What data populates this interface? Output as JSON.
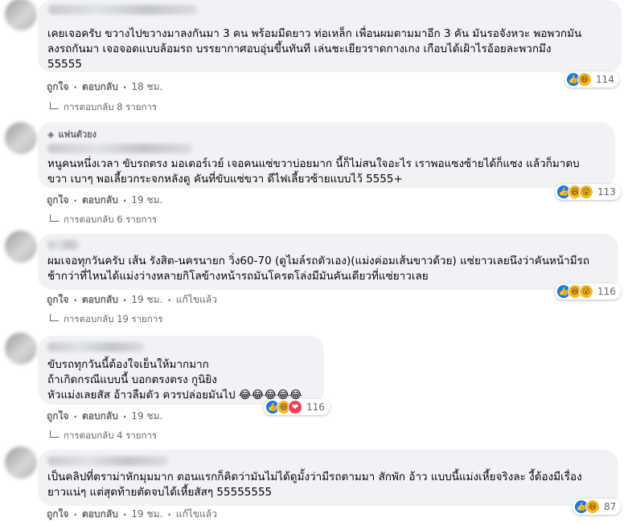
{
  "comments": [
    {
      "text": "เคยเจอครับ ขวางไปขวางมาลงกันมา 3 คน พร้อมมีดยาว ท่อเหล็ก เพื่อนผมตามมาอีก 3 คัน มันรอจังหวะ พอพวกมัน\nลงรถกันมา เจอจอดแบบล้อมรถ บรรยากาศอบอุ่นขึ้นทันที เล่นชะเยียวราดกางเกง เกือบได้เฝ้าไรอ้อยละพวกมึง\n55555",
      "like": "ถูกใจ",
      "reply": "ตอบกลับ",
      "time": "18 ชม.",
      "edited": "",
      "replies": "การตอบกลับ 8 รายการ",
      "reaction_count": "114",
      "reactions": [
        "like-icon",
        "haha-icon"
      ],
      "badge": ""
    },
    {
      "badge": "แฟนตัวยง",
      "text": "หนูคนหนึ่งเวลา ขับรถตรง มอเตอร์เวย์ เจอคนแซ่ขวาบ่อยมาก นี้ก็ไม่สนใจอะไร เราพอแซงซ้ายได้ก็แซง แล้วก็มาตบ\nขวา เบาๆ พอเลี้ยวกระจกหลังดู คันที่ขับแซ่ขวา ดีไฟเลี้ยวซ้ายแบบไว้ 5555+",
      "like": "ถูกใจ",
      "reply": "ตอบกลับ",
      "time": "19 ชม.",
      "edited": "",
      "replies": "การตอบกลับ 6 รายการ",
      "reaction_count": "113",
      "reactions": [
        "like-icon",
        "haha-icon",
        "wow-icon"
      ]
    },
    {
      "text": "ผมเจอทุกวันครับ เส้น รังสิต-นครนายก วิ่ง60-70 (ดูไมล์รถตัวเอง)(แม่งค่อมเส้นขาวด้วย) แซ่ยาวเลยนึงว่าคันหน้ามีรถ\nช้ากว่าที่ไหนได้แม่งว่างหลายกิโลข้างหน้ารถมันโครตโล่งมีมันคันเดียวที่แซ่ยาวเลย",
      "like": "ถูกใจ",
      "reply": "ตอบกลับ",
      "time": "19 ชม.",
      "edited": "แก้ไขแล้ว",
      "replies": "การตอบกลับ 19 รายการ",
      "reaction_count": "116",
      "reactions": [
        "like-icon",
        "haha-icon",
        "wow-icon"
      ],
      "badge": ""
    },
    {
      "text": "ขับรถทุกวันนี้ต้องใจเย็นให้มากมาก\nถ้าเกิดกรณีแบบนี้ บอกตรงตรง กูนิยิง\nหัวแม่งเลยสัส อ้าวลืมตัว ควรปล่อยมันไป 😂😂😂😂😂",
      "like": "ถูกใจ",
      "reply": "ตอบกลับ",
      "time": "19 ชม.",
      "edited": "",
      "replies": "การตอบกลับ 4 รายการ",
      "reaction_count": "116",
      "reactions": [
        "like-icon",
        "haha-icon",
        "love-icon"
      ],
      "badge": ""
    },
    {
      "text": "เป็นคลิปที่ตราม่าหักมุมมาก ตอนแรกก็คิดว่ามันไม่ได้ดูมั้งว่ามีรถตามมา สักพัก อ้าว แบบนี้แม่งเหี้ยจริงละ งี้ต้องมีเรื่อง\nยาวแน่ๆ แต่สุดท้ายตัดจบได้เหี้ยสัสๆ 55555555",
      "like": "ถูกใจ",
      "reply": "ตอบกลับ",
      "time": "19 ชม.",
      "edited": "แก้ไขแล้ว",
      "replies": "",
      "reaction_count": "87",
      "reactions": [
        "like-icon",
        "haha-icon"
      ],
      "badge": ""
    }
  ]
}
